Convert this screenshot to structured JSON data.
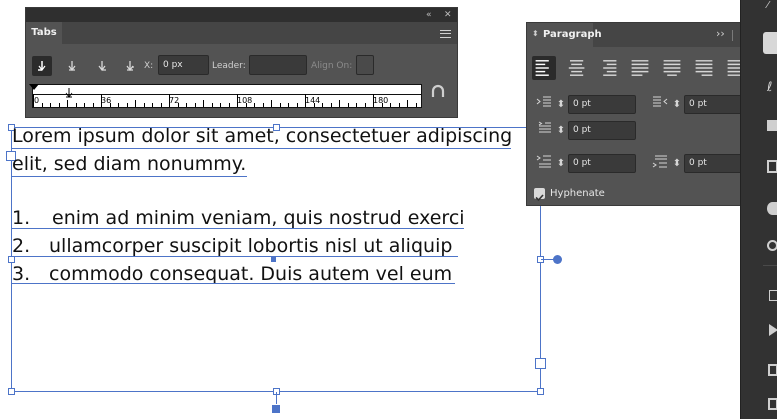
{
  "tabs_panel": {
    "title": "Tabs",
    "collapse_glyph": "«",
    "close_glyph": "✕",
    "x_label": "X:",
    "x_value": "0 px",
    "leader_label": "Leader:",
    "leader_value": "",
    "align_on_label": "Align On:",
    "align_on_value": "",
    "tab_buttons": [
      "left-justified-tab-icon",
      "center-justified-tab-icon",
      "right-justified-tab-icon",
      "align-to-decimal-tab-icon"
    ],
    "ruler": {
      "tick_labels": [
        "0",
        "36",
        "72",
        "108",
        "144",
        "180"
      ],
      "marker": "left-tab-marker"
    }
  },
  "paragraph_panel": {
    "title": "Paragraph",
    "align_buttons": [
      "align-left-icon",
      "align-center-icon",
      "align-right-icon",
      "justify-left-icon",
      "justify-center-icon",
      "justify-right-icon",
      "justify-all-icon"
    ],
    "left_indent": "0 pt",
    "right_indent": "0 pt",
    "first_line_indent": "0 pt",
    "space_before": "0 pt",
    "space_after": "0 pt",
    "hyphenate_label": "Hyphenate",
    "hyphenate_checked": true
  },
  "text_frame": {
    "line1": "Lorem ipsum dolor sit amet, consectetuer adipiscing",
    "line2": "elit, sed diam nonummy.",
    "list": [
      {
        "num": "1.",
        "text": "enim ad minim veniam, quis nostrud exerci"
      },
      {
        "num": "2.",
        "text": "ullamcorper suscipit lobortis nisl ut aliquip"
      },
      {
        "num": "3.",
        "text": "commodo consequat. Duis autem vel eum"
      }
    ]
  },
  "colors": {
    "panel_bg": "#535353",
    "titlebar_bg": "#2f2f2f",
    "selection_blue": "#4d74c8",
    "right_toolbar_bg": "#323232"
  }
}
